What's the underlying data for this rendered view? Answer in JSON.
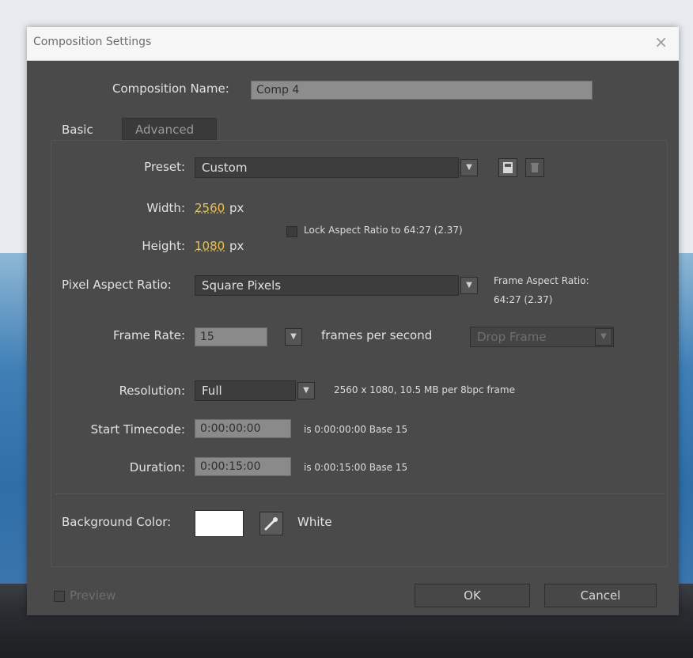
{
  "dialog": {
    "title": "Composition Settings",
    "close_glyph": "×",
    "composition_name_label": "Composition Name:",
    "composition_name_value": "Comp 4",
    "tabs": [
      {
        "label": "Basic",
        "active": true
      },
      {
        "label": "Advanced",
        "active": false
      }
    ],
    "preset": {
      "label": "Preset:",
      "value": "Custom"
    },
    "width": {
      "label": "Width:",
      "value": "2560",
      "unit": "px"
    },
    "height": {
      "label": "Height:",
      "value": "1080",
      "unit": "px"
    },
    "lock_aspect": {
      "label": "Lock Aspect Ratio to 64:27 (2.37)",
      "checked": false
    },
    "pixel_aspect": {
      "label": "Pixel Aspect Ratio:",
      "value": "Square Pixels"
    },
    "frame_aspect": {
      "label": "Frame Aspect Ratio:",
      "value": "64:27 (2.37)"
    },
    "frame_rate": {
      "label": "Frame Rate:",
      "value": "15",
      "suffix": "frames per second",
      "drop_frame": "Drop Frame"
    },
    "resolution": {
      "label": "Resolution:",
      "value": "Full",
      "info": "2560 x 1080, 10.5 MB per 8bpc frame"
    },
    "start_timecode": {
      "label": "Start Timecode:",
      "value": "0:00:00:00",
      "info": "is 0:00:00:00  Base 15"
    },
    "duration": {
      "label": "Duration:",
      "value": "0:00:15:00",
      "info": "is 0:00:15:00  Base 15"
    },
    "background_color": {
      "label": "Background Color:",
      "name": "White",
      "hex": "#ffffff"
    },
    "preview": {
      "label": "Preview",
      "checked": false
    },
    "buttons": {
      "ok": "OK",
      "cancel": "Cancel"
    }
  },
  "icons": [
    "close-icon",
    "save-preset-icon",
    "delete-preset-icon",
    "chevron-down-icon",
    "eyedropper-icon",
    "checkbox-icon"
  ],
  "colors": {
    "dialog_bg": "#4a4a4a",
    "value_accent": "#e9c14f",
    "titlebar_bg": "#f6f6f6"
  }
}
